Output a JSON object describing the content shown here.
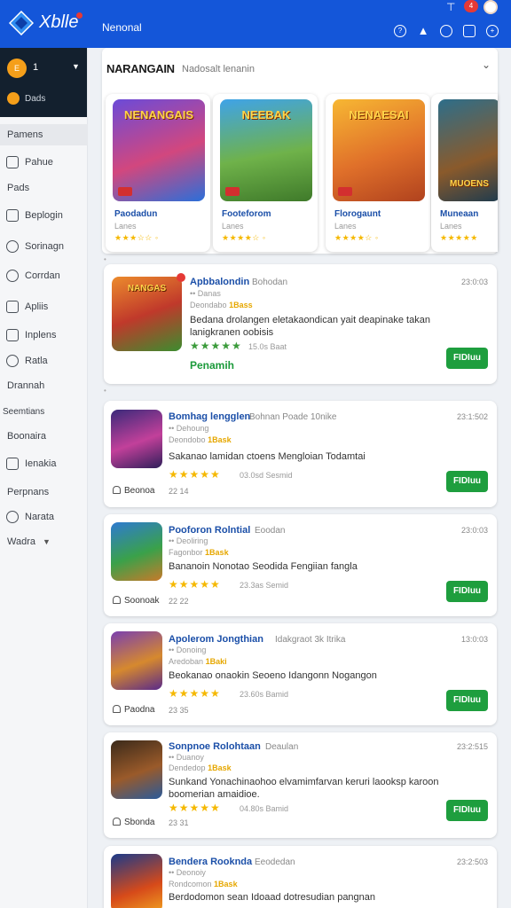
{
  "header": {
    "logo_text": "Xblle",
    "nav_title": "Nenonal",
    "notif_count": "4",
    "icons": [
      "help-icon",
      "triangle-icon",
      "globe-icon",
      "puzzle-icon",
      "settings-icon"
    ]
  },
  "sidebar": {
    "coin_label": "E",
    "count": "1",
    "sub_label": "Dads",
    "items": [
      {
        "label": "Pamens",
        "icon": "none"
      },
      {
        "label": "Pahue",
        "icon": "home-icon"
      },
      {
        "label": "Pads",
        "icon": "none"
      },
      {
        "label": "Beplogin",
        "icon": "gamepad-icon"
      },
      {
        "label": "Sorinagn",
        "icon": "chat-icon"
      },
      {
        "label": "Corrdan",
        "icon": "link-icon"
      },
      {
        "label": "Apliis",
        "icon": "grid-icon"
      },
      {
        "label": "Inplens",
        "icon": "calendar-icon"
      },
      {
        "label": "Ratla",
        "icon": "clock-icon"
      },
      {
        "label": "Drannah",
        "icon": "none"
      },
      {
        "label": "Seemtians",
        "icon": "none"
      },
      {
        "label": "Boonaira",
        "icon": "none"
      },
      {
        "label": "Ienakia",
        "icon": "list-icon"
      },
      {
        "label": "Perpnans",
        "icon": "none"
      },
      {
        "label": "Narata",
        "icon": "info-icon"
      },
      {
        "label": "Wadra",
        "icon": "none"
      }
    ]
  },
  "featured": {
    "title": "NARANGAIN",
    "subtitle": "Nadosalt lenanin",
    "cards": [
      {
        "art": "NENANGAIS",
        "name": "Paodadun",
        "meta": "Lanes",
        "stars": "★★★☆☆ ◦"
      },
      {
        "art": "NEEBAK",
        "name": "Footeforom",
        "meta": "Lanes",
        "stars": "★★★★☆ ◦"
      },
      {
        "art": "NENAESAI",
        "name": "Florogaunt",
        "meta": "Lanes",
        "stars": "★★★★☆ ◦"
      },
      {
        "art": "MUOENS",
        "name": "Muneaan",
        "meta": "Lanes",
        "stars": "★★★★★"
      }
    ]
  },
  "listings": [
    {
      "art": "NANGAS",
      "title": "Apbbalondin",
      "subtitle": "Bohodan",
      "time": "23:0:03",
      "meta": "•• Danas",
      "tagline_pre": "Deondabo",
      "tagline_tag": "1Bass",
      "desc": "Bedana drolangen eletakaondican yait deapinake takan lanigkranen oobisis",
      "stars": "★★★★★",
      "rating": "15.0s  Baat",
      "price": "Penamih",
      "button": "FIDIuu"
    },
    {
      "title": "Bomhag lengglen",
      "subtitle": "Bohnan Poade 10nike",
      "time": "23:1:502",
      "meta": "•• Dehoung",
      "tagline_pre": "Deondobo",
      "tagline_tag": "1Bask",
      "desc": "Sakanao lamidan ctoens Mengloian Todamtai",
      "stars": "★★★★★",
      "rating": "03.0sd  Sesmid",
      "footer": "Beonoa",
      "footer_num": "22 14",
      "button": "FIDIuu"
    },
    {
      "title": "Pooforon Rolntial",
      "subtitle": "Eoodan",
      "time": "23:0:03",
      "meta": "•• Deoliring",
      "tagline_pre": "Fagonbor",
      "tagline_tag": "1Bask",
      "desc": "Bananoin Nonotao Seodida Fengiian fangla",
      "stars": "★★★★★",
      "rating": "23.3as  Semid",
      "footer": "Soonoak",
      "footer_num": "22 22",
      "button": "FIDIuu"
    },
    {
      "title": "Apolerom Jongthian",
      "subtitle": "Idakgraot 3k Itrika",
      "time": "13:0:03",
      "meta": "•• Donoing",
      "tagline_pre": "Aredoban",
      "tagline_tag": "1Baki",
      "desc": "Beokanao onaokin Seoeno Idangonn Nogangon",
      "stars": "★★★★★",
      "rating": "23.60s  Bamid",
      "footer": "Paodna",
      "footer_num": "23 35",
      "button": "FIDIuu"
    },
    {
      "title": "Sonpnoe Rolohtaan",
      "subtitle": "Deaulan",
      "time": "23:2:515",
      "meta": "•• Duanoy",
      "tagline_pre": "Dendedop",
      "tagline_tag": "1Bask",
      "desc": "Sunkand Yonachinaohoo elvamimfarvan keruri laooksp karoon boomerian amaidioe.",
      "stars": "★★★★★",
      "rating": "04.80s  Bamid",
      "footer": "Sbonda",
      "footer_num": "23 31",
      "button": "FIDIuu"
    },
    {
      "title": "Bendera Rooknda",
      "subtitle": "Eeodedan",
      "time": "23:2:503",
      "meta": "•• Deonoiy",
      "tagline_pre": "Rondcomon",
      "tagline_tag": "1Bask",
      "desc": "Berdodomon sean Idoaad dotresudian pangnan",
      "stars": "",
      "rating": "",
      "button": "FIDIuu"
    }
  ],
  "colors": {
    "topbar": "#1456d9",
    "sidebar_head": "#13202e",
    "accent_green": "#1e9e3e",
    "link_blue": "#1b4fa8",
    "star": "#f5b800"
  }
}
